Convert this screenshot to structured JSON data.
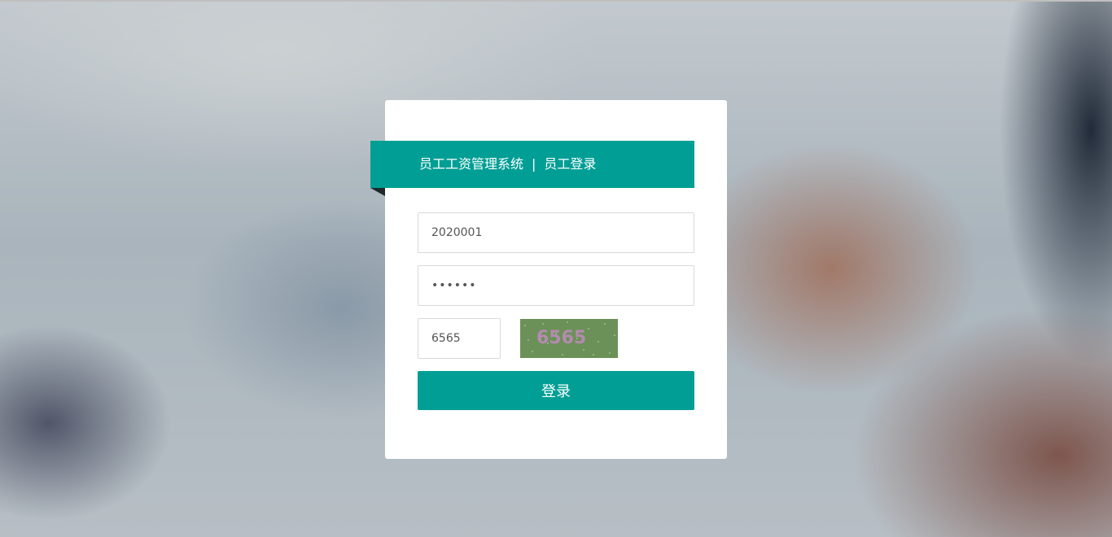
{
  "header": {
    "system_name": "员工工资管理系统",
    "separator": "|",
    "page_name": "员工登录"
  },
  "form": {
    "username_value": "2020001",
    "password_value": "123456",
    "captcha_input_value": "6565",
    "captcha_image_text": "6565",
    "login_label": "登录"
  },
  "colors": {
    "accent": "#009e94",
    "captcha_bg": "#6b9158",
    "captcha_text": "#b58ab0"
  }
}
